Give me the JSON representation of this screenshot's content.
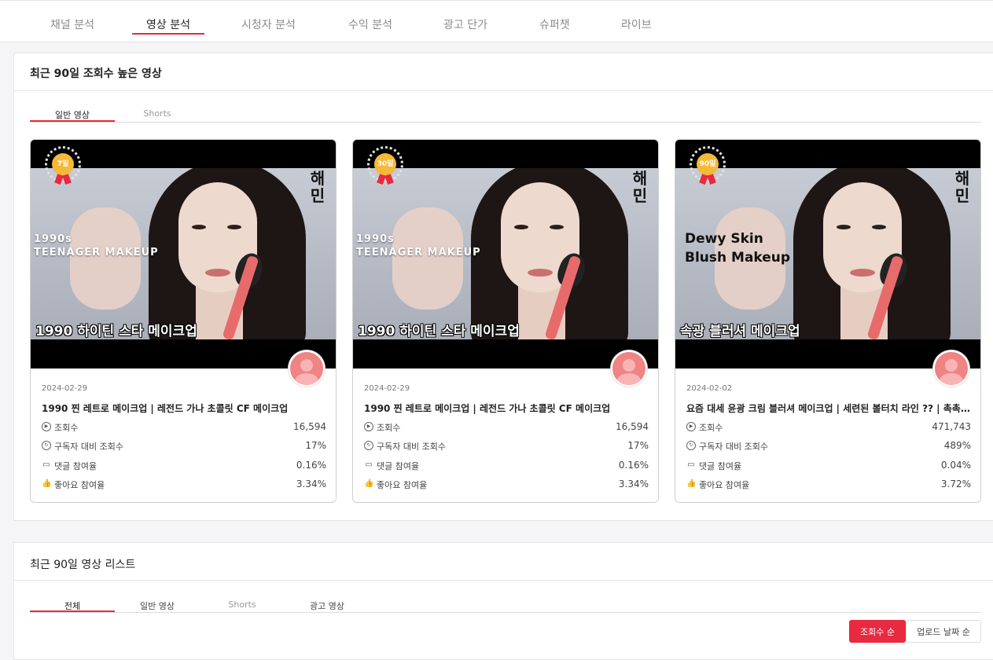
{
  "nav": {
    "tabs": [
      "채널 분석",
      "영상 분석",
      "시청자 분석",
      "수익 분석",
      "광고 단가",
      "슈퍼챗",
      "라이브"
    ],
    "active_index": 1
  },
  "top_videos": {
    "title": "최근 90일 조회수 높은 영상",
    "tabs": [
      "일반 영상",
      "Shorts"
    ],
    "active_tab": 0,
    "cards": [
      {
        "badge": "7일",
        "thumb_en": "1990s\nTEENAGER MAKEUP",
        "thumb_kr": "1990 하이틴 스타 메이크업",
        "brand": "해민",
        "date": "2024-02-29",
        "title": "1990 찐 레트로 메이크업 | 레전드 가나 초콜릿 CF 메이크업",
        "stats": [
          {
            "label": "조회수",
            "value": "16,594",
            "icon": "play-circle-icon"
          },
          {
            "label": "구독자 대비 조회수",
            "value": "17%",
            "icon": "subscriber-ratio-icon"
          },
          {
            "label": "댓글 참여율",
            "value": "0.16%",
            "icon": "comment-icon"
          },
          {
            "label": "좋아요 참여율",
            "value": "3.34%",
            "icon": "thumbs-up-icon"
          }
        ]
      },
      {
        "badge": "30일",
        "thumb_en": "1990s\nTEENAGER MAKEUP",
        "thumb_kr": "1990 하이틴 스타 메이크업",
        "brand": "해민",
        "date": "2024-02-29",
        "title": "1990 찐 레트로 메이크업 | 레전드 가나 초콜릿 CF 메이크업",
        "stats": [
          {
            "label": "조회수",
            "value": "16,594",
            "icon": "play-circle-icon"
          },
          {
            "label": "구독자 대비 조회수",
            "value": "17%",
            "icon": "subscriber-ratio-icon"
          },
          {
            "label": "댓글 참여율",
            "value": "0.16%",
            "icon": "comment-icon"
          },
          {
            "label": "좋아요 참여율",
            "value": "3.34%",
            "icon": "thumbs-up-icon"
          }
        ]
      },
      {
        "badge": "90일",
        "thumb_en": "Dewy Skin\nBlush Makeup",
        "thumb_kr": "속광 블러셔 메이크업",
        "brand": "해민",
        "date": "2024-02-02",
        "title": "요즘 대세 윤광 크림 블러셔 메이크업 | 세련된 볼터치 라인 ?? | 촉촉한 피부 표현",
        "stats": [
          {
            "label": "조회수",
            "value": "471,743",
            "icon": "play-circle-icon"
          },
          {
            "label": "구독자 대비 조회수",
            "value": "489%",
            "icon": "subscriber-ratio-icon"
          },
          {
            "label": "댓글 참여율",
            "value": "0.04%",
            "icon": "comment-icon"
          },
          {
            "label": "좋아요 참여율",
            "value": "3.72%",
            "icon": "thumbs-up-icon"
          }
        ]
      }
    ]
  },
  "video_list": {
    "title": "최근 90일 영상 리스트",
    "tabs": [
      "전체",
      "일반 영상",
      "Shorts",
      "광고 영상"
    ],
    "active_tab": 0,
    "sort": {
      "views": "조회수 순",
      "upload": "업로드 날짜 순"
    }
  },
  "colors": {
    "accent": "#e8293f",
    "medal": "#f4b938"
  }
}
